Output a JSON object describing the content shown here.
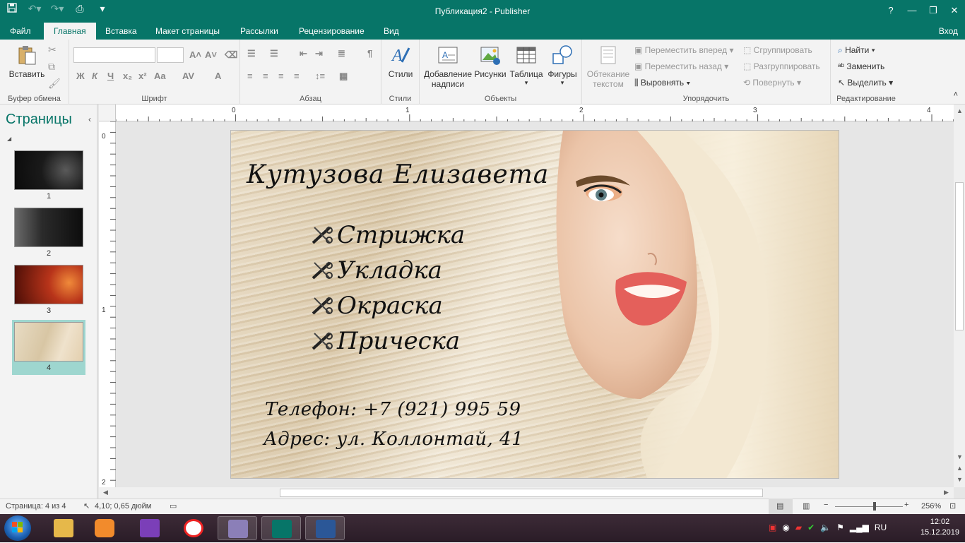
{
  "window": {
    "title": "Публикация2 - Publisher",
    "help": "?",
    "signin": "Вход"
  },
  "tabs": [
    "Файл",
    "Главная",
    "Вставка",
    "Макет страницы",
    "Рассылки",
    "Рецензирование",
    "Вид"
  ],
  "ribbon": {
    "clipboard": {
      "paste": "Вставить",
      "label": "Буфер обмена"
    },
    "font": {
      "label": "Шрифт",
      "bold": "Ж",
      "italic": "К",
      "underline": "Ч",
      "sub": "x₂",
      "sup": "x²",
      "case": "Aa",
      "spacing": "AV",
      "color": "A"
    },
    "paragraph": {
      "label": "Абзац"
    },
    "styles": {
      "button": "Стили",
      "label": "Стили"
    },
    "objects": {
      "label": "Объекты",
      "textbox_line1": "Добавление",
      "textbox_line2": "надписи",
      "pictures": "Рисунки",
      "table": "Таблица",
      "shapes": "Фигуры"
    },
    "arrange": {
      "label": "Упорядочить",
      "wrap_line1": "Обтекание",
      "wrap_line2": "текстом",
      "bring_forward": "Переместить вперед",
      "send_backward": "Переместить назад",
      "align": "Выровнять",
      "group": "Сгруппировать",
      "ungroup": "Разгруппировать",
      "rotate": "Повернуть"
    },
    "editing": {
      "label": "Редактирование",
      "find": "Найти",
      "replace": "Заменить",
      "select": "Выделить"
    }
  },
  "pages_panel": {
    "title": "Страницы",
    "pages": [
      {
        "num": "1"
      },
      {
        "num": "2"
      },
      {
        "num": "3"
      },
      {
        "num": "4"
      }
    ],
    "selected": 4
  },
  "rulers": {
    "h": [
      "0",
      "1",
      "2",
      "3",
      "4"
    ],
    "v": [
      "0",
      "1",
      "2"
    ]
  },
  "card": {
    "name": "Кутузова Елизавета",
    "services": [
      "Стрижка",
      "Укладка",
      "Окраска",
      "Прическа"
    ],
    "phone": "Телефон: +7 (921) 995 59",
    "address": "Адрес: ул. Коллонтай, 41"
  },
  "status": {
    "page": "Страница: 4 из 4",
    "position": "4,10; 0,65 дюйм",
    "zoom": "256%"
  },
  "taskbar": {
    "time": "12:02",
    "date": "15.12.2019"
  }
}
